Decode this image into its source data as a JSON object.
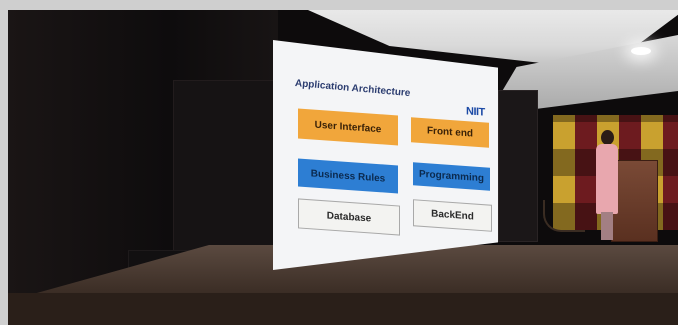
{
  "slide": {
    "title": "Application Architecture",
    "logo": "NIIT",
    "boxes": [
      {
        "label": "User Interface",
        "style": "orange"
      },
      {
        "label": "Front end",
        "style": "orange"
      },
      {
        "label": "Business Rules",
        "style": "blue"
      },
      {
        "label": "Programming",
        "style": "blue"
      },
      {
        "label": "Database",
        "style": "gray"
      },
      {
        "label": "BackEnd",
        "style": "gray"
      }
    ]
  },
  "colors": {
    "orange": "#f1a63b",
    "blue": "#2d7ed3",
    "slide_bg": "#f4f5f7",
    "title": "#2c3d70",
    "logo": "#1c4aa6"
  }
}
